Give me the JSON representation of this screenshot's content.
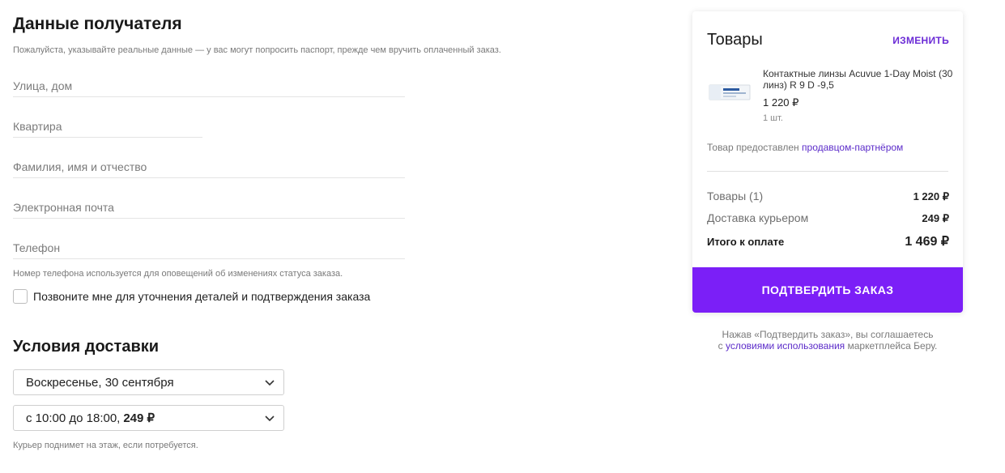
{
  "recipient": {
    "title": "Данные получателя",
    "notice": "Пожалуйста, указывайте реальные данные — у вас могут попросить паспорт, прежде чем вручить оплаченный заказ.",
    "street_placeholder": "Улица, дом",
    "apartment_placeholder": "Квартира",
    "name_placeholder": "Фамилия, имя и отчество",
    "email_placeholder": "Электронная почта",
    "phone_placeholder": "Телефон",
    "phone_hint": "Номер телефона используется для оповещений об изменениях статуса заказа.",
    "callback_label": "Позвоните мне для уточнения деталей и подтверждения заказа"
  },
  "delivery": {
    "title": "Условия доставки",
    "date_value": "Воскресенье, 30 сентября",
    "time_value": "с 10:00 до 18:00,",
    "time_price": "249 ₽",
    "courier_note": "Курьер поднимет на этаж, если потребуется."
  },
  "summary": {
    "title": "Товары",
    "edit_label": "ИЗМЕНИТЬ",
    "product": {
      "name": "Контактные линзы Acuvue 1-Day Moist (30 линз) R 9 D -9,5",
      "price": "1 220 ₽",
      "quantity": "1 шт."
    },
    "seller_prefix": "Товар предоставлен",
    "seller_link": "продавцом-партнёром",
    "goods_label": "Товары (1)",
    "goods_value": "1 220 ₽",
    "delivery_label": "Доставка курьером",
    "delivery_value": "249 ₽",
    "total_label": "Итого к оплате",
    "total_value": "1 469 ₽",
    "confirm_label": "ПОДТВЕРДИТЬ ЗАКАЗ"
  },
  "legal": {
    "line1": "Нажав «Подтвердить заказ», вы соглашаетесь",
    "prefix": "с",
    "link": "условиями использования",
    "suffix": "маркетплейса Беру."
  },
  "colors": {
    "accent": "#7b1ff7",
    "link": "#5b2bc9"
  }
}
